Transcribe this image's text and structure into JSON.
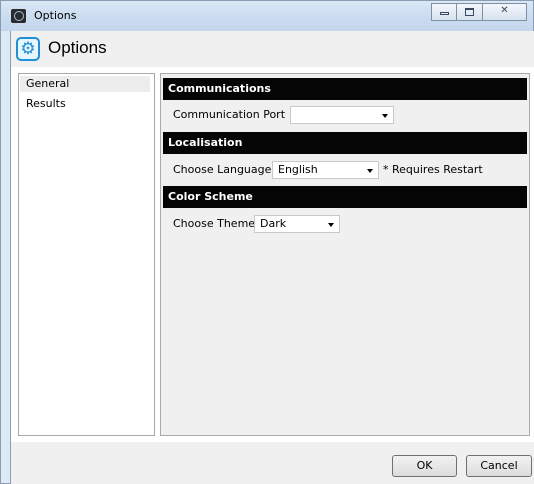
{
  "window": {
    "title": "Options",
    "caption_buttons": {
      "minimize_icon": "minimize-icon",
      "maximize_icon": "maximize-icon",
      "close_glyph": "✕"
    }
  },
  "header": {
    "icon": "gear-icon",
    "title": "Options"
  },
  "nav": {
    "items": [
      {
        "label": "General",
        "selected": true
      },
      {
        "label": "Results",
        "selected": false
      }
    ]
  },
  "sections": {
    "communications": {
      "title": "Communications",
      "port_label": "Communication Port",
      "port_value": ""
    },
    "localisation": {
      "title": "Localisation",
      "language_label": "Choose Language",
      "language_value": "English",
      "language_note": "* Requires Restart"
    },
    "color_scheme": {
      "title": "Color Scheme",
      "theme_label": "Choose Theme",
      "theme_value": "Dark"
    }
  },
  "footer": {
    "ok_label": "OK",
    "cancel_label": "Cancel"
  },
  "colors": {
    "section_header_bg": "#050505",
    "accent": "#1e90d6"
  }
}
